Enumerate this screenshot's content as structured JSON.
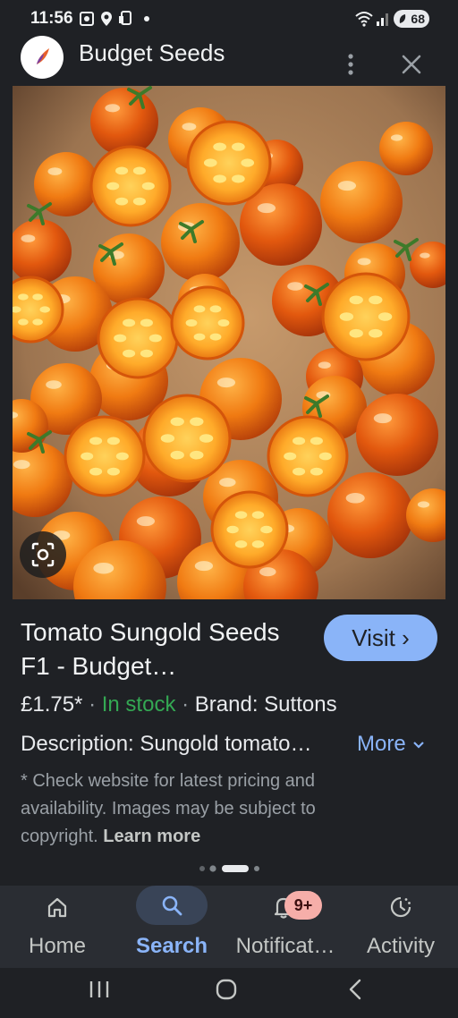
{
  "status_bar": {
    "time": "11:56",
    "battery": "68",
    "icons": [
      "screenshot-icon",
      "location-icon",
      "cast-icon",
      "dot-icon",
      "wifi-icon",
      "signal-icon",
      "battery-icon"
    ]
  },
  "header": {
    "site_name": "Budget Seeds",
    "logo_icon": "budget-seeds-logo-icon",
    "menu_icon": "more-vert-icon",
    "close_icon": "close-icon"
  },
  "image": {
    "description_icon": "lens-icon"
  },
  "product": {
    "title": "Tomato Sungold Seeds F1 - Budget…",
    "visit_label": "Visit ›",
    "price": "£1.75*",
    "stock": "In stock",
    "brand": "Brand: Suttons",
    "description": "Description: Sungold tomato…",
    "more_label": "More",
    "disclaimer": "* Check website for latest pricing and availability. Images may be subject to copyright.",
    "learn_more": "Learn more"
  },
  "carousel": {
    "page_count": 4,
    "active_index": 2
  },
  "bottom_nav": {
    "items": [
      {
        "label": "Home",
        "icon": "home-icon"
      },
      {
        "label": "Search",
        "icon": "search-icon"
      },
      {
        "label": "Notificat…",
        "icon": "bell-icon",
        "badge": "9+"
      },
      {
        "label": "Activity",
        "icon": "activity-icon"
      }
    ],
    "active": "Search"
  },
  "colors": {
    "background": "#1f2125",
    "accent": "#8ab4f8",
    "stock_green": "#34a853",
    "badge": "#f6aea9"
  }
}
